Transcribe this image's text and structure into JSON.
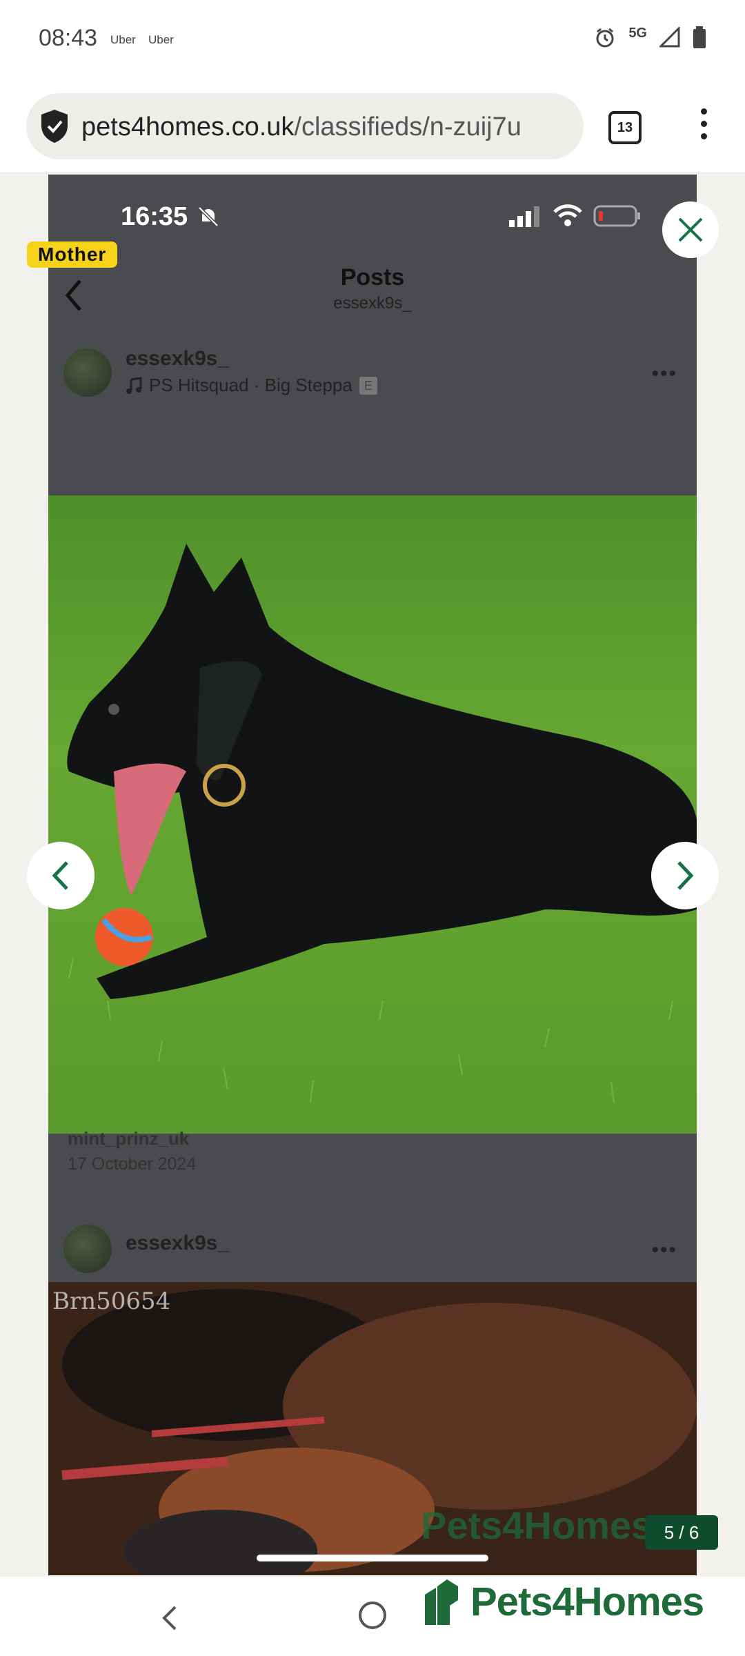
{
  "status_bar": {
    "time": "08:43",
    "apps": [
      "Uber",
      "Uber"
    ],
    "network": "5G",
    "icons": [
      "alarm-icon",
      "signal-icon",
      "battery-icon"
    ]
  },
  "browser": {
    "url_domain": "pets4homes.co.uk",
    "url_path": "/classifieds/n-zuij7u",
    "tab_count": "13",
    "icons": [
      "shield-icon",
      "more-vert-icon"
    ]
  },
  "gallery": {
    "badge": "Mother",
    "counter": "5 / 6",
    "inner_screenshot": {
      "time": "16:35",
      "title": "Posts",
      "subtitle": "essexk9s_",
      "post1": {
        "user": "essexk9s_",
        "music": "PS Hitsquad · Big Steppa",
        "explicit": "E"
      },
      "partial_caption": "mint_prinz_uk",
      "post_date": "17 October 2024",
      "post2": {
        "user": "essexk9s_"
      },
      "watermark_code": "Brn50654",
      "watermark_logo": "Pets4Homes"
    }
  },
  "footer": {
    "brand": "Pets4Homes"
  },
  "colors": {
    "brand_green": "#1e6a38",
    "badge_yellow": "#f6d21b",
    "counter_bg": "#0f4b2d",
    "close_green": "#157347"
  }
}
